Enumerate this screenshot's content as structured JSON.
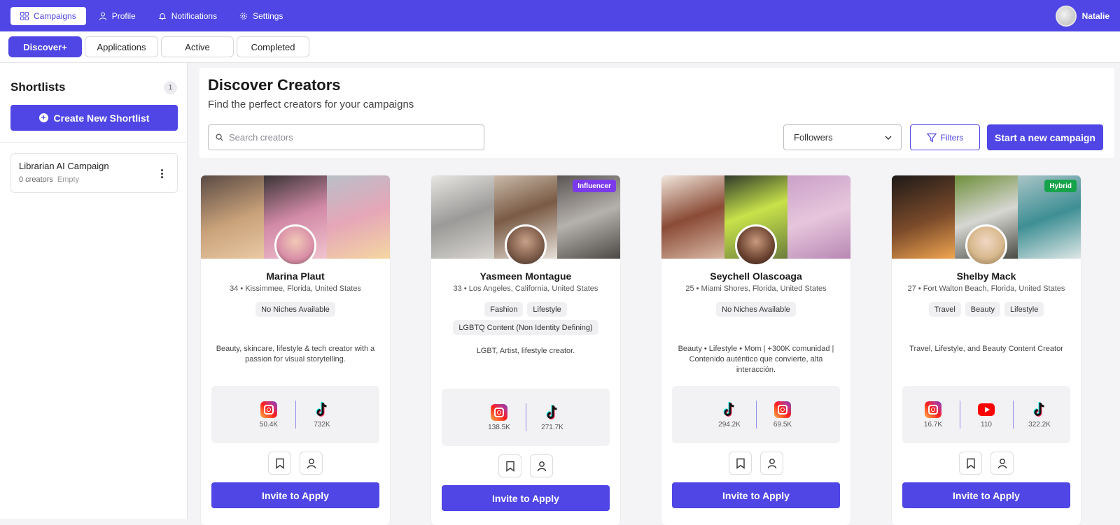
{
  "nav": {
    "items": [
      {
        "label": "Campaigns",
        "icon": "grid-icon",
        "active": true
      },
      {
        "label": "Profile",
        "icon": "user-icon",
        "active": false
      },
      {
        "label": "Notifications",
        "icon": "bell-icon",
        "active": false
      },
      {
        "label": "Settings",
        "icon": "gear-icon",
        "active": false
      }
    ],
    "user_name": "Natalie"
  },
  "tabs": [
    "Discover+",
    "Applications",
    "Active",
    "Completed"
  ],
  "sidebar": {
    "title": "Shortlists",
    "count": "1",
    "create_label": "Create New Shortlist",
    "shortlists": [
      {
        "name": "Librarian AI Campaign",
        "creators": "0 creators",
        "status": "Empty"
      }
    ]
  },
  "main": {
    "title": "Discover Creators",
    "subtitle": "Find the perfect creators for your campaigns",
    "search_placeholder": "Search creators",
    "sort_value": "Followers",
    "filters_label": "Filters",
    "start_label": "Start a new campaign"
  },
  "cards": [
    {
      "name": "Marina Plaut",
      "location": "34 • Kissimmee, Florida, United States",
      "badge": "",
      "niches": [
        "No Niches Available"
      ],
      "bio": "Beauty, skincare, lifestyle & tech creator with a passion for visual storytelling.",
      "stats": [
        {
          "platform": "instagram",
          "value": "50.4K"
        },
        {
          "platform": "tiktok",
          "value": "732K"
        }
      ],
      "invite_label": "Invite to Apply"
    },
    {
      "name": "Yasmeen Montague",
      "location": "33 • Los Angeles, California, United States",
      "badge": "Influencer",
      "niches": [
        "Fashion",
        "Lifestyle",
        "LGBTQ Content (Non Identity Defining)"
      ],
      "bio": "LGBT, Artist, lifestyle creator.",
      "stats": [
        {
          "platform": "instagram",
          "value": "138.5K"
        },
        {
          "platform": "tiktok",
          "value": "271.7K"
        }
      ],
      "invite_label": "Invite to Apply"
    },
    {
      "name": "Seychell Olascoaga",
      "location": "25 • Miami Shores, Florida, United States",
      "badge": "",
      "niches": [
        "No Niches Available"
      ],
      "bio": "Beauty • Lifestyle • Mom | +300K comunidad | Contenido auténtico que convierte, alta interacción.",
      "stats": [
        {
          "platform": "tiktok",
          "value": "294.2K"
        },
        {
          "platform": "instagram",
          "value": "69.5K"
        }
      ],
      "invite_label": "Invite to Apply"
    },
    {
      "name": "Shelby Mack",
      "location": "27 • Fort Walton Beach, Florida, United States",
      "badge": "Hybrid",
      "niches": [
        "Travel",
        "Beauty",
        "Lifestyle"
      ],
      "bio": "Travel, Lifestyle, and Beauty Content Creator",
      "stats": [
        {
          "platform": "instagram",
          "value": "16.7K"
        },
        {
          "platform": "youtube",
          "value": "110"
        },
        {
          "platform": "tiktok",
          "value": "322.2K"
        }
      ],
      "invite_label": "Invite to Apply"
    }
  ],
  "colors": {
    "accent": "#4f46e5",
    "influencer_badge": "#7c3aed",
    "hybrid_badge": "#16a34a"
  }
}
